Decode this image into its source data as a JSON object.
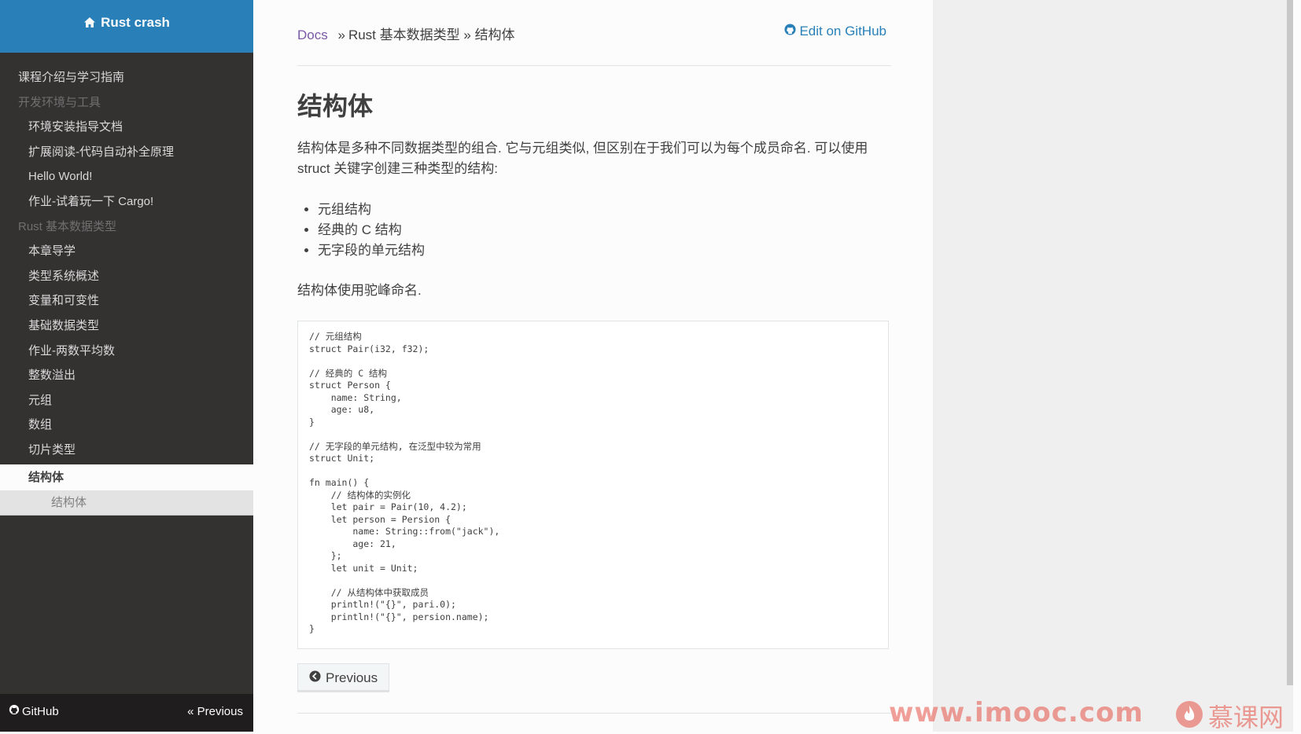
{
  "sidebar": {
    "brand": "Rust crash",
    "items": [
      {
        "label": "课程介绍与学习指南",
        "kind": "top"
      },
      {
        "label": "开发环境与工具",
        "kind": "caption"
      },
      {
        "label": "环境安装指导文档",
        "kind": "sub"
      },
      {
        "label": "扩展阅读-代码自动补全原理",
        "kind": "sub"
      },
      {
        "label": "Hello World!",
        "kind": "sub"
      },
      {
        "label": "作业-试着玩一下 Cargo!",
        "kind": "sub"
      },
      {
        "label": "Rust 基本数据类型",
        "kind": "caption"
      },
      {
        "label": "本章导学",
        "kind": "sub"
      },
      {
        "label": "类型系统概述",
        "kind": "sub"
      },
      {
        "label": "变量和可变性",
        "kind": "sub"
      },
      {
        "label": "基础数据类型",
        "kind": "sub"
      },
      {
        "label": "作业-两数平均数",
        "kind": "sub"
      },
      {
        "label": "整数溢出",
        "kind": "sub"
      },
      {
        "label": "元组",
        "kind": "sub"
      },
      {
        "label": "数组",
        "kind": "sub"
      },
      {
        "label": "切片类型",
        "kind": "sub"
      },
      {
        "label": "结构体",
        "kind": "current"
      },
      {
        "label": "结构体",
        "kind": "current-child"
      }
    ],
    "footer": {
      "github": "GitHub",
      "previous": "« Previous"
    }
  },
  "breadcrumbs": {
    "docs": "Docs",
    "sep": "»",
    "section": "Rust 基本数据类型",
    "sep2": "»",
    "current": "结构体",
    "edit": "Edit on GitHub"
  },
  "content": {
    "title": "结构体",
    "intro": "结构体是多种不同数据类型的组合. 它与元组类似, 但区别在于我们可以为每个成员命名. 可以使用 struct 关键字创建三种类型的结构:",
    "bullets": [
      "元组结构",
      "经典的 C 结构",
      "无字段的单元结构"
    ],
    "naming": "结构体使用驼峰命名.",
    "code": "// 元组结构\nstruct Pair(i32, f32);\n\n// 经典的 C 结构\nstruct Person {\n    name: String,\n    age: u8,\n}\n\n// 无字段的单元结构, 在泛型中较为常用\nstruct Unit;\n\nfn main() {\n    // 结构体的实例化\n    let pair = Pair(10, 4.2);\n    let person = Persion {\n        name: String::from(\"jack\"),\n        age: 21,\n    };\n    let unit = Unit;\n\n    // 从结构体中获取成员\n    println!(\"{}\", pari.0);\n    println!(\"{}\", persion.name);\n}",
    "previous_button": "Previous"
  },
  "watermark": {
    "url": "www.imooc.com",
    "brand": "慕课网"
  },
  "colors": {
    "sidebar_bg": "#343131",
    "brand_bg": "#2980b9",
    "link": "#2980b9",
    "docs_link": "#7a58a5"
  }
}
